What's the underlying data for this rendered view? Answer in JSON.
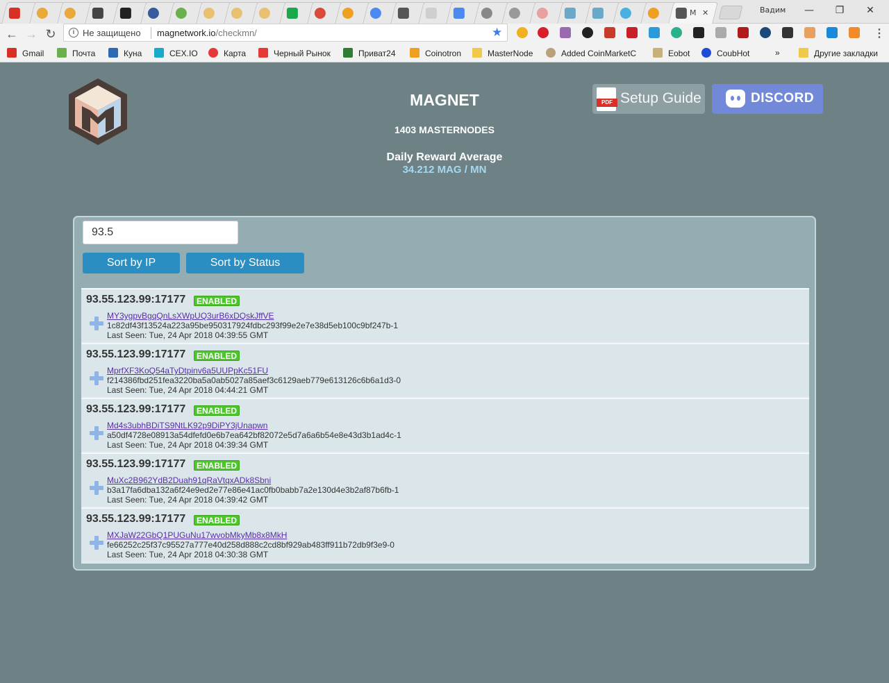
{
  "browser": {
    "active_tab_label": "M",
    "user_name": "Вадим",
    "window_buttons": {
      "minimize": "—",
      "restore": "❐",
      "close": "✕"
    },
    "security_label": "Не защищено",
    "url_host": "magnetwork.io",
    "url_path": "/checkmn/",
    "bookmarks": [
      {
        "label": "Gmail",
        "icon_color": "#d93025"
      },
      {
        "label": "Почта",
        "icon_color": "#6ab04c"
      },
      {
        "label": "Куна",
        "icon_color": "#2d6ab3"
      },
      {
        "label": "CEX.IO",
        "icon_color": "#1ca8c9"
      },
      {
        "label": "Карта",
        "icon_color": "#e53935"
      },
      {
        "label": "Черный Рынок",
        "icon_color": "#e53935"
      },
      {
        "label": "Приват24",
        "icon_color": "#2e7d32"
      },
      {
        "label": "Coinotron",
        "icon_color": "#f0a020"
      },
      {
        "label": "MasterNode",
        "icon_color": "#f0c94a"
      },
      {
        "label": "Added CoinMarketC",
        "icon_color": "#b9a27a"
      },
      {
        "label": "Eobot",
        "icon_color": "#c8b07a"
      },
      {
        "label": "CoubHot",
        "icon_color": "#1e4bd8"
      }
    ],
    "bookmarks_overflow": "»",
    "other_bookmarks": "Другие закладки"
  },
  "header": {
    "title": "MAGNET",
    "masternode_count": "1403 MASTERNODES",
    "reward_label": "Daily Reward Average",
    "reward_value": "34.212 MAG / MN",
    "setup_guide_label": "Setup Guide",
    "pdf_tag": "PDF",
    "discord_label": "DISCORD"
  },
  "controls": {
    "search_value": "93.5",
    "sort_by_ip": "Sort by IP",
    "sort_by_status": "Sort by Status"
  },
  "masternodes": [
    {
      "ip": "93.55.123.99:17177",
      "status": "ENABLED",
      "address": "MY3ygpvBgqQnLsXWpUQ3urB6xDQskJffVE",
      "txid": "1c82df43f13524a223a95be950317924fdbc293f99e2e7e38d5eb100c9bf247b-1",
      "last_seen": "Last Seen: Tue, 24 Apr 2018 04:39:55 GMT"
    },
    {
      "ip": "93.55.123.99:17177",
      "status": "ENABLED",
      "address": "MprfXF3KoQ54aTyDtpinv6a5UUPpKc51FU",
      "txid": "f214386fbd251fea3220ba5a0ab5027a85aef3c6129aeb779e613126c6b6a1d3-0",
      "last_seen": "Last Seen: Tue, 24 Apr 2018 04:44:21 GMT"
    },
    {
      "ip": "93.55.123.99:17177",
      "status": "ENABLED",
      "address": "Md4s3ubhBDiTS9NtLK92p9DiPY3jUnapwn",
      "txid": "a50df4728e08913a54dfefd0e6b7ea642bf82072e5d7a6a6b54e8e43d3b1ad4c-1",
      "last_seen": "Last Seen: Tue, 24 Apr 2018 04:39:34 GMT"
    },
    {
      "ip": "93.55.123.99:17177",
      "status": "ENABLED",
      "address": "MuXc2B962YdB2Duah91qRaVtqxADk8Sbni",
      "txid": "b3a17fa6dba132a6f24e9ed2e77e86e41ac0fb0babb7a2e130d4e3b2af87b6fb-1",
      "last_seen": "Last Seen: Tue, 24 Apr 2018 04:39:42 GMT"
    },
    {
      "ip": "93.55.123.99:17177",
      "status": "ENABLED",
      "address": "MXJaW22GbQ1PUGuNu17wvobMkyMb8x8MkH",
      "txid": "fe66252c25f37c95527a777e40d258d888c2cd8bf929ab483ff911b72db9f3e9-0",
      "last_seen": "Last Seen: Tue, 24 Apr 2018 04:30:38 GMT"
    }
  ],
  "colors": {
    "page_bg": "#6e8286",
    "panel_bg": "#93adb3",
    "button_blue": "#2b8ec3",
    "badge_green": "#4cc62a",
    "reward_cyan": "#a8d8ef",
    "discord": "#7289da"
  }
}
